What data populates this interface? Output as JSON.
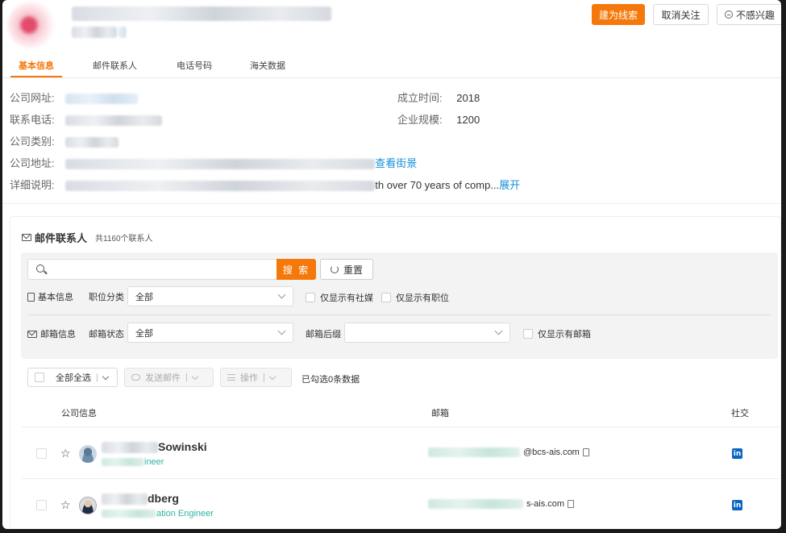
{
  "header": {
    "primary_button": "建为线索",
    "unfollow_button": "取消关注",
    "not_interested_button": "不感兴趣"
  },
  "tabs": [
    {
      "label": "基本信息",
      "active": true
    },
    {
      "label": "邮件联系人"
    },
    {
      "label": "电话号码"
    },
    {
      "label": "海关数据"
    }
  ],
  "info": {
    "website_label": "公司网址:",
    "phone_label": "联系电话:",
    "category_label": "公司类别:",
    "address_label": "公司地址:",
    "street_view_link": "查看街景",
    "detail_label": "详细说明:",
    "detail_visible_tail": "th over 70 years of comp...",
    "expand_link": "展开",
    "founded_label": "成立时间:",
    "founded_value": "2018",
    "scale_label": "企业规模:",
    "scale_value": "1200"
  },
  "contacts": {
    "title": "邮件联系人",
    "count_text": "共1160个联系人",
    "search_button": "搜 索",
    "reset_button": "重置",
    "basic_info_label": "基本信息",
    "job_category_label": "职位分类",
    "job_category_value": "全部",
    "only_social_label": "仅显示有社媒",
    "only_job_label": "仅显示有职位",
    "email_info_label": "邮箱信息",
    "email_status_label": "邮箱状态",
    "email_status_value": "全部",
    "email_suffix_label": "邮箱后缀",
    "email_suffix_value": "",
    "only_email_label": "仅显示有邮箱",
    "select_all_button": "全部全选",
    "send_email_button": "发送邮件",
    "actions_button": "操作",
    "selected_count_text": "已勾选0条数据",
    "columns": {
      "company_info": "公司信息",
      "email": "邮箱",
      "social": "社交"
    },
    "rows": [
      {
        "name_visible": "Sowinski",
        "title_visible": "ineer",
        "email_visible": "@bcs-ais.com"
      },
      {
        "name_visible": "dberg",
        "title_visible": "ation Engineer",
        "email_visible": "s-ais.com"
      }
    ]
  },
  "colors": {
    "accent": "#f5780a",
    "link": "#1890d8",
    "job_title": "#2fb3a4",
    "linkedin": "#0a66c2"
  }
}
